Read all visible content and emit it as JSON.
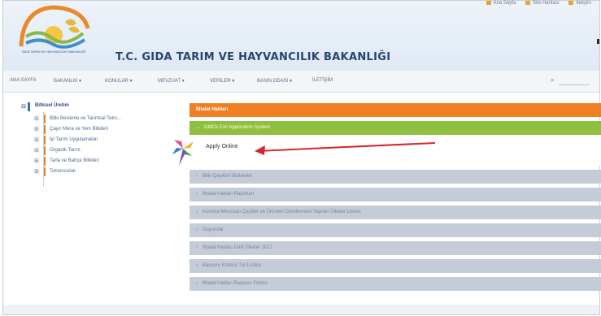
{
  "header": {
    "title": "T.C. GIDA TARIM VE HAYVANCILIK BAKANLIĞI",
    "logo_caption": "GIDA TARIM VE HAYVANCILIK BAKANLIĞI",
    "top_links": [
      "Ana Sayfa",
      "Site Haritası",
      "İletişim"
    ]
  },
  "nav": {
    "items": [
      "ANA SAYFA",
      "BAKANLIK",
      "KONULAR",
      "MEVZUAT",
      "VERİLER",
      "BASIN ODASI",
      "İLETİŞİM"
    ]
  },
  "sidebar": {
    "root": "Bitkisel Üretim",
    "items": [
      "Bitki Besleme ve Tarımsal Tekn...",
      "Çayır Mera ve Yem Bitkileri",
      "İyi Tarım Uygulamaları",
      "Organik Tarım",
      "Tarla ve Bahçe Bitkileri",
      "Tohumculuk"
    ]
  },
  "panel": {
    "header": "İthalat Hakları",
    "expanded_section": "GMOs Exit Application System",
    "apply_link": "Apply Online",
    "sections": [
      "Bitki Çeşitleri Bültenleri",
      "İthalat Hakları Raporları",
      "Koruma Mevzuatı Çeşitler ve Ürünleri Göndermesi Yapılan Ülkeler Listesi",
      "Duyurular",
      "İthalat Hakları İzinli Ülkeler 2017",
      "Başvuru Kontrol Tür Listesi",
      "İthalat Hakları Başvuru Formu"
    ]
  },
  "colors": {
    "panel_header": "#ee7f23",
    "expanded_row": "#8fbf3f",
    "collapsed_row": "#c3ccd7",
    "arrow": "#d6262a",
    "title": "#24466f"
  }
}
